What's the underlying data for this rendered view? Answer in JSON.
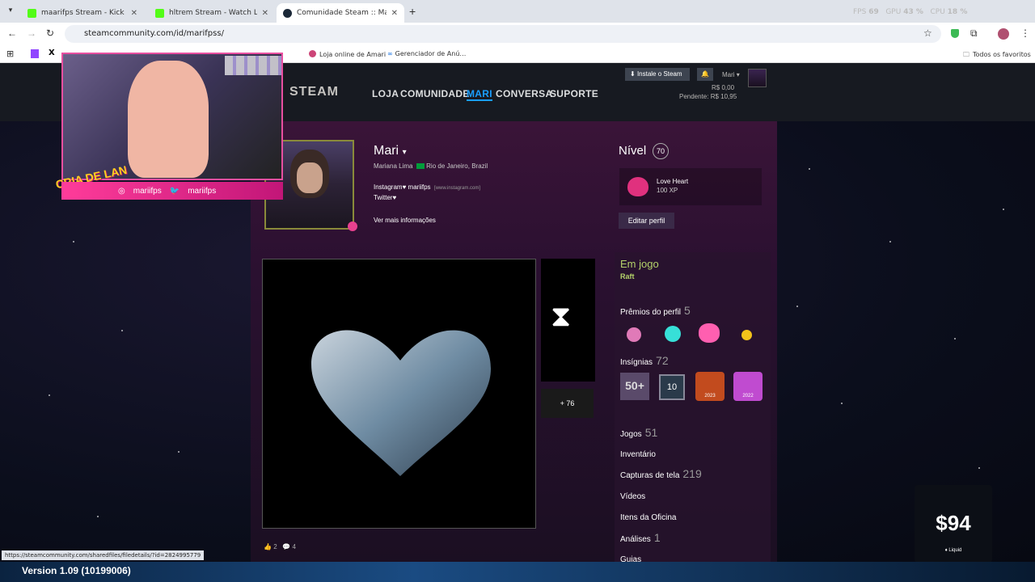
{
  "browser": {
    "tabs": [
      {
        "label": "maarifps Stream - Kick Dashbo…",
        "fav_color": "#53fc18"
      },
      {
        "label": "hltrem Stream - Watch Live on …",
        "fav_color": "#53fc18"
      },
      {
        "label": "Comunidade Steam :: Mari",
        "fav_color": "#1b2838"
      }
    ],
    "url": "steamcommunity.com/id/marifpss/",
    "bookmarks": [
      "Loja online de Amari",
      "Gerenciador de Anú…"
    ],
    "all_favorites": "Todos os favoritos",
    "perf": {
      "fps_label": "FPS",
      "fps": "69",
      "gpu_label": "GPU",
      "gpu": "43 %",
      "cpu_label": "CPU",
      "cpu": "18 %"
    }
  },
  "steam": {
    "logo": "STEAM",
    "nav": [
      "LOJA",
      "COMUNIDADE",
      "MARI",
      "CONVERSA",
      "SUPORTE"
    ],
    "install_button": "Instale o Steam",
    "account_name": "Mari",
    "wallet": "R$ 0,00",
    "pending": "Pendente: R$ 10,95"
  },
  "profile": {
    "name": "Mari",
    "real_name": "Mariana Lima",
    "location": "Rio de Janeiro, Brazil",
    "social_line1": "Instagram♥ mariifps",
    "social_line1_url": "[www.instagram.com]",
    "social_line2": "Twitter♥",
    "more_info": "Ver mais informações",
    "level_label": "Nível",
    "level": "70",
    "badge_name": "Love Heart",
    "badge_xp": "100 XP",
    "edit_button": "Editar perfil",
    "showcase_more": "+ 76",
    "likes": "2",
    "comments": "4"
  },
  "sidebar": {
    "in_game_label": "Em jogo",
    "game": "Raft",
    "awards_label": "Prêmios do perfil",
    "awards_count": "5",
    "badges_label": "Insígnias",
    "badges_count": "72",
    "badge_tiles": [
      "50+",
      "10",
      "2023",
      "2022"
    ],
    "games_label": "Jogos",
    "games_count": "51",
    "inventory": "Inventário",
    "screenshots_label": "Capturas de tela",
    "screenshots_count": "219",
    "videos": "Vídeos",
    "workshop": "Itens da Oficina",
    "reviews_label": "Análises",
    "reviews_count": "1",
    "guides": "Guias"
  },
  "stream_overlay": {
    "brand": "CRIA DE LAN",
    "instagram": "mariifps",
    "twitter": "mariifps"
  },
  "ticket": {
    "price": "$94",
    "label": "♦ Liquid"
  },
  "status_url": "https://steamcommunity.com/sharedfiles/filedetails/?id=2824995779",
  "taskbar": {
    "version": "Version 1.09 (10199006)"
  }
}
